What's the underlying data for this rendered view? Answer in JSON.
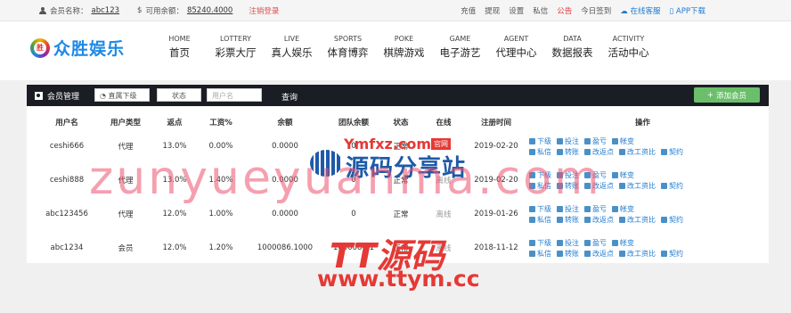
{
  "topbar": {
    "member_label": "会员名称：",
    "member_value": "abc123",
    "balance_label": "可用余额：",
    "balance_value": "85240.4000",
    "logout": "注销登录",
    "links": [
      "充值",
      "提现",
      "设置",
      "私信"
    ],
    "announce": "公告",
    "checkin": "今日签到",
    "service": "在线客服",
    "app": "APP下载"
  },
  "logo": {
    "badge": "胜",
    "text": "众胜娱乐"
  },
  "nav": [
    {
      "en": "HOME",
      "cn": "首页"
    },
    {
      "en": "LOTTERY",
      "cn": "彩票大厅"
    },
    {
      "en": "LIVE",
      "cn": "真人娱乐"
    },
    {
      "en": "SPORTS",
      "cn": "体育博弈"
    },
    {
      "en": "POKE",
      "cn": "棋牌游戏"
    },
    {
      "en": "GAME",
      "cn": "电子游艺"
    },
    {
      "en": "AGENT",
      "cn": "代理中心"
    },
    {
      "en": "DATA",
      "cn": "数据报表"
    },
    {
      "en": "ACTIVITY",
      "cn": "活动中心"
    }
  ],
  "toolbar": {
    "title": "会员管理",
    "level_select": "直属下级",
    "status_select": "状态",
    "username_placeholder": "用户名",
    "query": "查询",
    "add_member": "添加会员"
  },
  "table": {
    "headers": [
      "用户名",
      "用户类型",
      "返点",
      "工资%",
      "余额",
      "团队余额",
      "状态",
      "在线",
      "注册时间",
      "操作"
    ],
    "rows": [
      {
        "username": "ceshi666",
        "type": "代理",
        "rebate": "13.0%",
        "wage": "0.00%",
        "balance": "0.0000",
        "team": "0",
        "status": "正常",
        "online": "离线",
        "date": "2019-02-20"
      },
      {
        "username": "ceshi888",
        "type": "代理",
        "rebate": "13.0%",
        "wage": "1.40%",
        "balance": "0.0000",
        "team": "0",
        "status": "正常",
        "online": "离线",
        "date": "2019-02-20"
      },
      {
        "username": "abc123456",
        "type": "代理",
        "rebate": "12.0%",
        "wage": "1.00%",
        "balance": "0.0000",
        "team": "0",
        "status": "正常",
        "online": "离线",
        "date": "2019-01-26"
      },
      {
        "username": "abc1234",
        "type": "会员",
        "rebate": "12.0%",
        "wage": "1.20%",
        "balance": "1000086.1000",
        "team": "1000086.1",
        "status": "正常",
        "online": "离线",
        "date": "2018-11-12"
      }
    ],
    "ops_line1": [
      "下级",
      "投注",
      "盈亏",
      "帐变"
    ],
    "ops_line2": [
      "私信",
      "转账",
      "改返点",
      "改工资比",
      "契约"
    ]
  },
  "watermark": {
    "big": "zunyueyuanma.com",
    "site_top": "Ymfxz.com",
    "site_badge": "官网",
    "site_main": "源码分享站",
    "tt": "TT源码",
    "url": "www.ttym.cc"
  },
  "colors": {
    "accent": "#1e7bd0",
    "toolbar_bg": "#1b1d24",
    "add_button": "#6bbf6b",
    "logout": "#d9534f",
    "watermark": "#e53935"
  }
}
